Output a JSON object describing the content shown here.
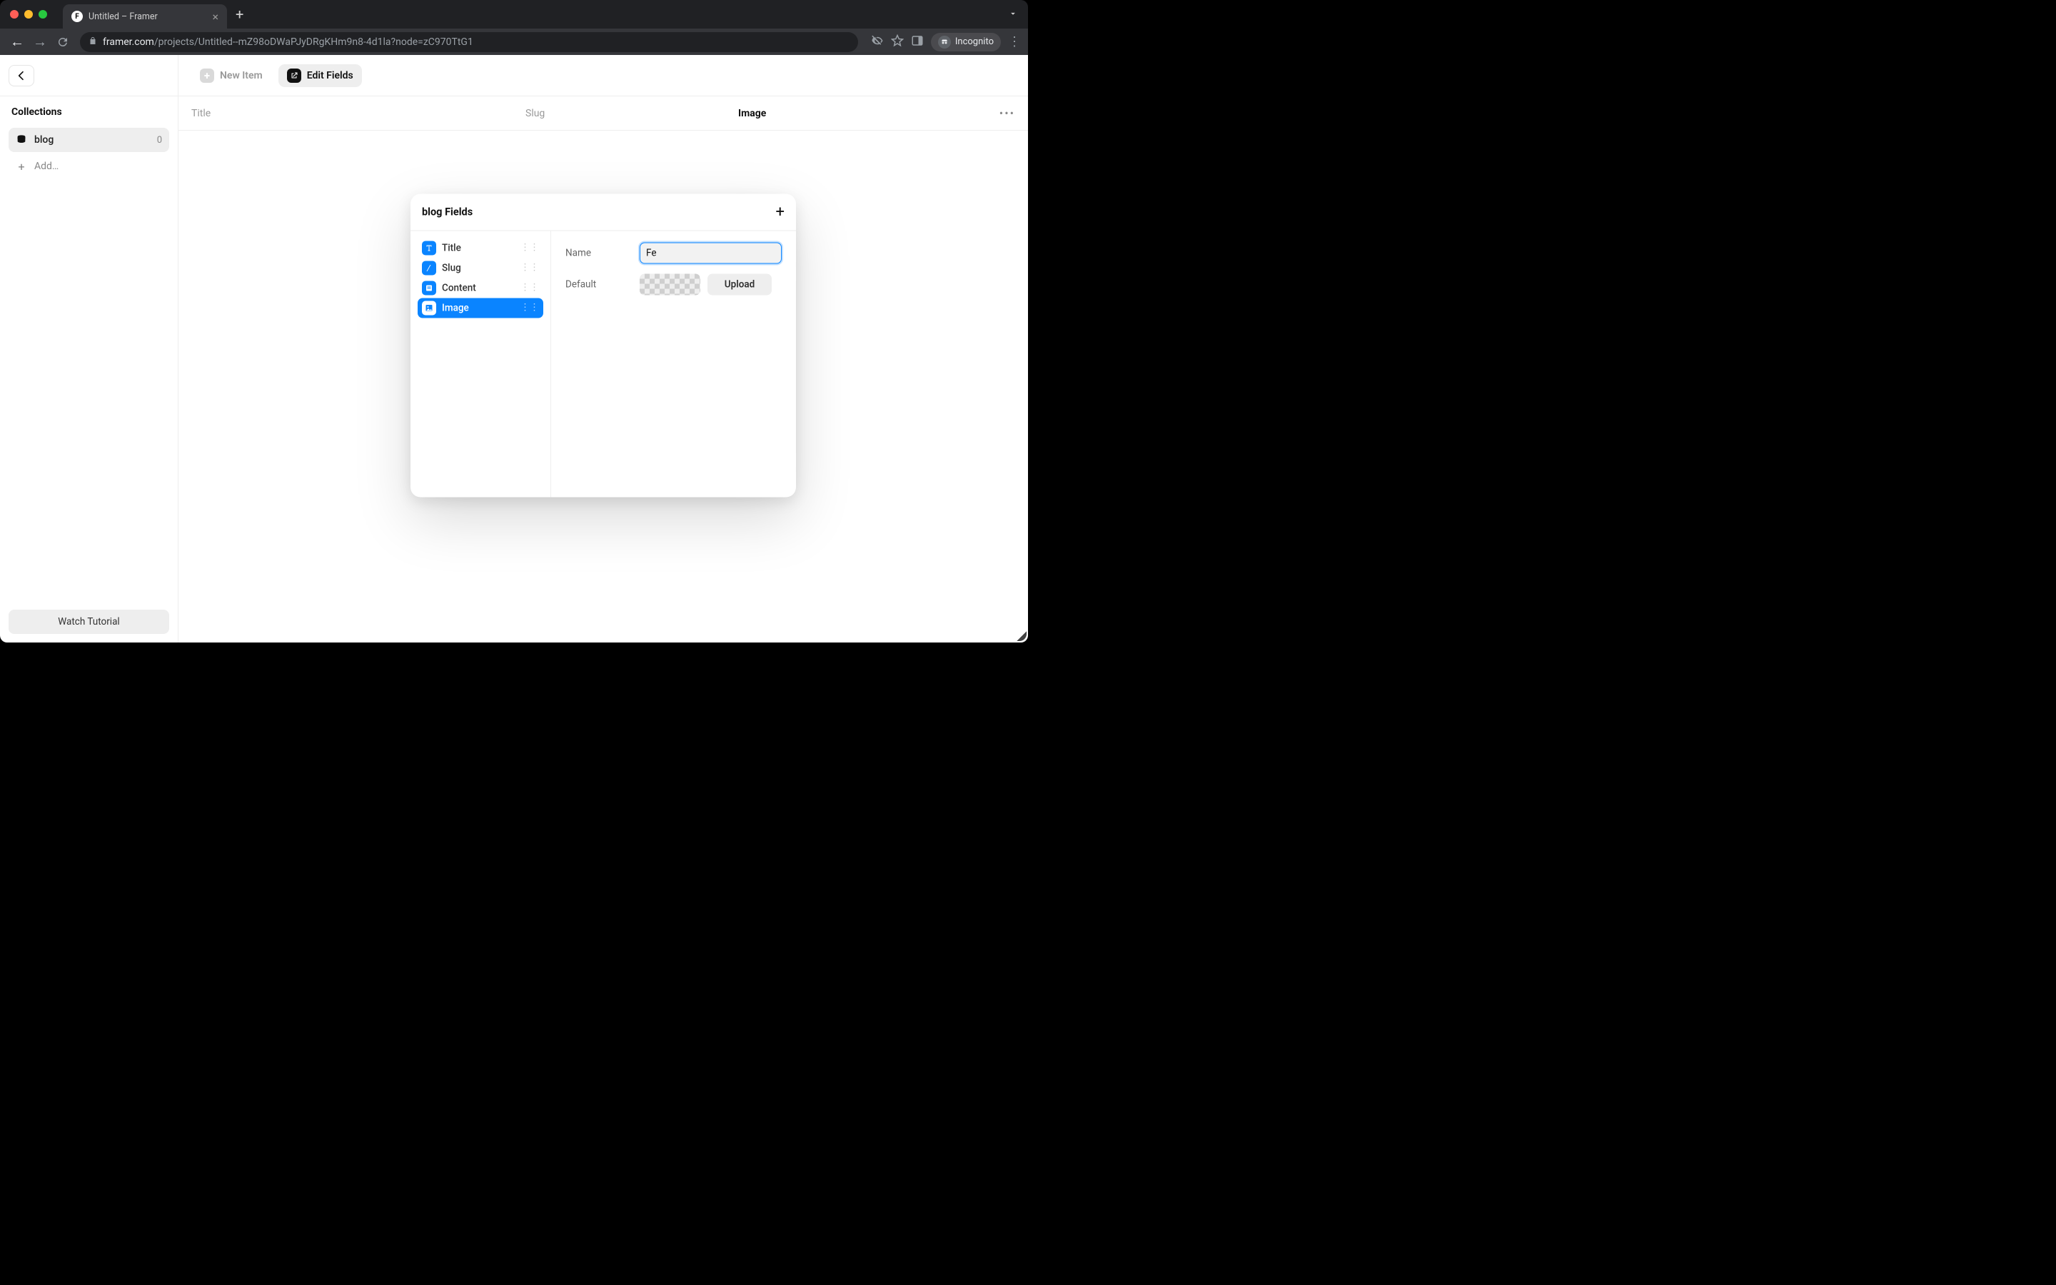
{
  "browser": {
    "tab_title": "Untitled – Framer",
    "url_domain": "framer.com",
    "url_path": "/projects/Untitled--mZ98oDWaPJyDRgKHm9n8-4d1la?node=zC970TtG1",
    "incognito_label": "Incognito"
  },
  "toolbar": {
    "new_item": "New Item",
    "edit_fields": "Edit Fields"
  },
  "sidebar": {
    "heading": "Collections",
    "items": [
      {
        "name": "blog",
        "count": "0"
      }
    ],
    "add_label": "Add…",
    "watch_tutorial": "Watch Tutorial"
  },
  "table": {
    "columns": {
      "title": "Title",
      "slug": "Slug",
      "image": "Image"
    }
  },
  "modal": {
    "title": "blog Fields",
    "fields": [
      {
        "label": "Title",
        "icon": "text"
      },
      {
        "label": "Slug",
        "icon": "slug"
      },
      {
        "label": "Content",
        "icon": "content"
      },
      {
        "label": "Image",
        "icon": "image",
        "selected": true
      }
    ],
    "detail": {
      "name_label": "Name",
      "name_value": "Fe",
      "default_label": "Default",
      "upload_label": "Upload"
    }
  }
}
